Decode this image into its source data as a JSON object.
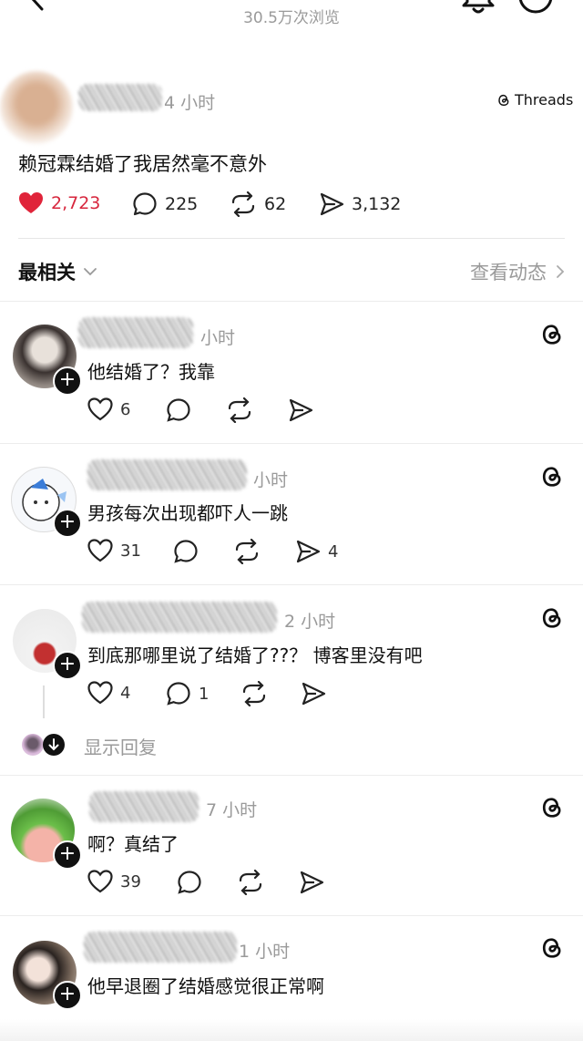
{
  "header": {
    "views": "30.5万次浏览"
  },
  "post": {
    "time": "4 小时",
    "source": "Threads",
    "text": "赖冠霖结婚了我居然毫不意外",
    "likes": "2,723",
    "comments": "225",
    "reposts": "62",
    "shares": "3,132"
  },
  "sort": {
    "label": "最相关",
    "view_activity": "查看动态"
  },
  "comments": [
    {
      "time": "小时",
      "text": "他结婚了？我靠",
      "likes": "6",
      "replies": "",
      "shares": ""
    },
    {
      "time": "小时",
      "text": "男孩每次出现都吓人一跳",
      "likes": "31",
      "replies": "",
      "shares": "4"
    },
    {
      "time": "2 小时",
      "text": "到底那哪里说了结婚了??？ 博客里没有吧",
      "likes": "4",
      "replies": "1",
      "shares": ""
    },
    {
      "time": "7 小时",
      "text": "啊？真结了",
      "likes": "39",
      "replies": "",
      "shares": ""
    },
    {
      "time": "1 小时",
      "text": "他早退圈了结婚感觉很正常啊",
      "likes": "",
      "replies": "",
      "shares": ""
    }
  ],
  "show_replies": "显示回复",
  "colors": {
    "like_red": "#d7263d",
    "muted": "#9a9a9a"
  }
}
